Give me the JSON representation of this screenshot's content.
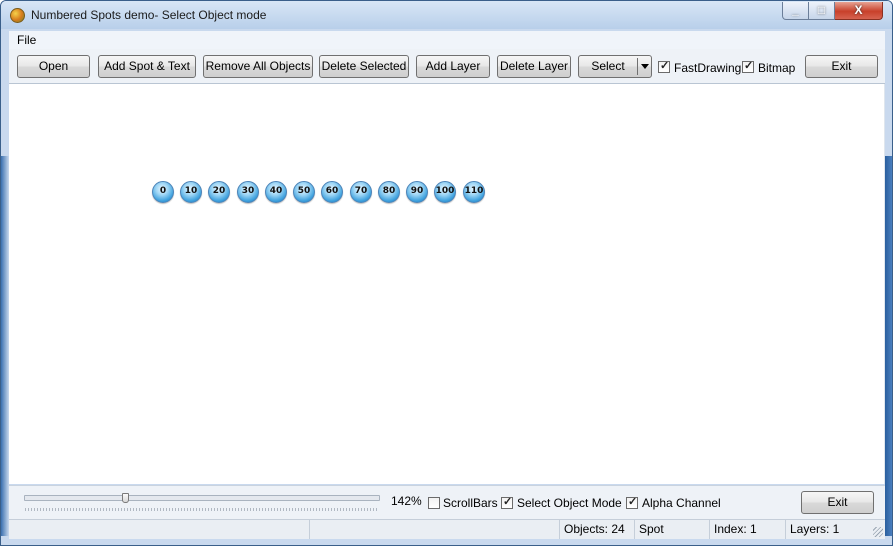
{
  "window": {
    "title": "Numbered Spots demo- Select Object mode",
    "controls": {
      "minimize": "_",
      "maximize": "□",
      "close": "X"
    }
  },
  "menu": {
    "file": "File"
  },
  "toolbar": {
    "open": "Open",
    "add_spot_text": "Add Spot & Text",
    "remove_all": "Remove All Objects",
    "delete_selected": "Delete Selected",
    "add_layer": "Add Layer",
    "delete_layer": "Delete Layer",
    "select_value": "Select",
    "fast_drawing": {
      "label": "FastDrawing",
      "checked": true
    },
    "bitmap": {
      "label": "Bitmap",
      "checked": true
    },
    "exit": "Exit"
  },
  "spots": [
    "0",
    "10",
    "20",
    "30",
    "40",
    "50",
    "60",
    "70",
    "80",
    "90",
    "100",
    "110"
  ],
  "bottom": {
    "zoom_slider_value": 142,
    "zoom_text": "142%",
    "scrollbars": {
      "label": "ScrollBars",
      "checked": false
    },
    "select_object_mode": {
      "label": "Select Object Mode",
      "checked": true
    },
    "alpha_channel": {
      "label": "Alpha Channel",
      "checked": true
    },
    "exit": "Exit"
  },
  "status": {
    "objects": "Objects: 24",
    "type": "Spot",
    "index": "Index: 1",
    "layers": "Layers: 1"
  },
  "colors": {
    "spot_fill": "#3da0dd",
    "window_frame": "#c9d9ee",
    "close_button": "#c8402a"
  }
}
